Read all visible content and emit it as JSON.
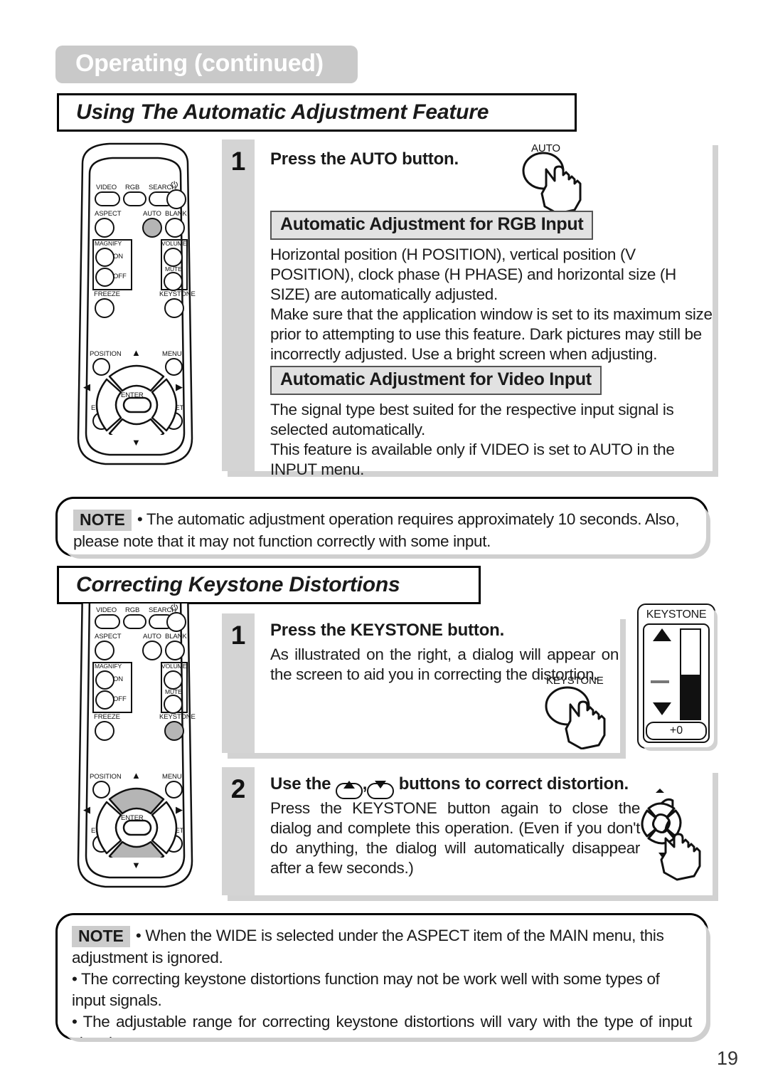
{
  "header": {
    "title": "Operating (continued)"
  },
  "page_number": "19",
  "sections": [
    {
      "title": "Using The Automatic Adjustment Feature",
      "step": {
        "number": "1",
        "heading": "Press the AUTO button.",
        "button_icon_label": "AUTO"
      },
      "subsections": [
        {
          "heading": "Automatic Adjustment for RGB Input",
          "paragraphs": [
            "Horizontal position (H POSITION), vertical position (V POSITION), clock phase (H PHASE) and horizontal size (H SIZE) are automatically adjusted.",
            "Make sure that the application window is set to its maximum size prior to attempting to use this feature. Dark pictures may still be incorrectly adjusted. Use a bright screen when adjusting."
          ]
        },
        {
          "heading": "Automatic Adjustment for Video Input",
          "paragraphs": [
            "The signal type best suited for the respective input signal is selected automatically.",
            "This feature is available only if VIDEO is set to AUTO in the INPUT menu."
          ]
        }
      ],
      "note": {
        "label": "NOTE",
        "text": "• The automatic adjustment operation requires approximately 10 seconds. Also, please note that it may not function correctly with some input."
      }
    },
    {
      "title": "Correcting Keystone Distortions",
      "step1": {
        "number": "1",
        "heading": "Press the KEYSTONE button.",
        "body": "As illustrated on the right, a dialog will appear on the screen to aid you in correcting the distortion.",
        "button_icon_label": "KEYSTONE"
      },
      "step2": {
        "number": "2",
        "heading_before": "Use the",
        "heading_mid": ",",
        "heading_after": "buttons to correct distortion.",
        "body": "Press the KEYSTONE button again to close the dialog and complete this operation. (Even if you don't do anything, the dialog will automatically disappear after a few seconds.)"
      },
      "osd": {
        "title": "KEYSTONE",
        "value": "+0",
        "fill_percent": 50
      },
      "note": {
        "label": "NOTE",
        "lines": [
          "• When the WIDE is selected under the ASPECT item of the MAIN menu, this adjustment is ignored.",
          "• The correcting keystone distortions function may not be work well with some types of input signals.",
          "• The adjustable range for correcting keystone distortions will vary with the type of input signal."
        ]
      }
    }
  ],
  "remote": {
    "buttons": [
      "VIDEO",
      "RGB",
      "SEARCH",
      "POWER",
      "ASPECT",
      "AUTO",
      "BLANK",
      "MAGNIFY",
      "ON",
      "OFF",
      "VOLUME",
      "MUTE",
      "FREEZE",
      "KEYSTONE",
      "POSITION",
      "MENU",
      "ENTER",
      "ESC",
      "RESET"
    ],
    "highlight_auto": "AUTO",
    "highlight_keystone": "KEYSTONE"
  }
}
